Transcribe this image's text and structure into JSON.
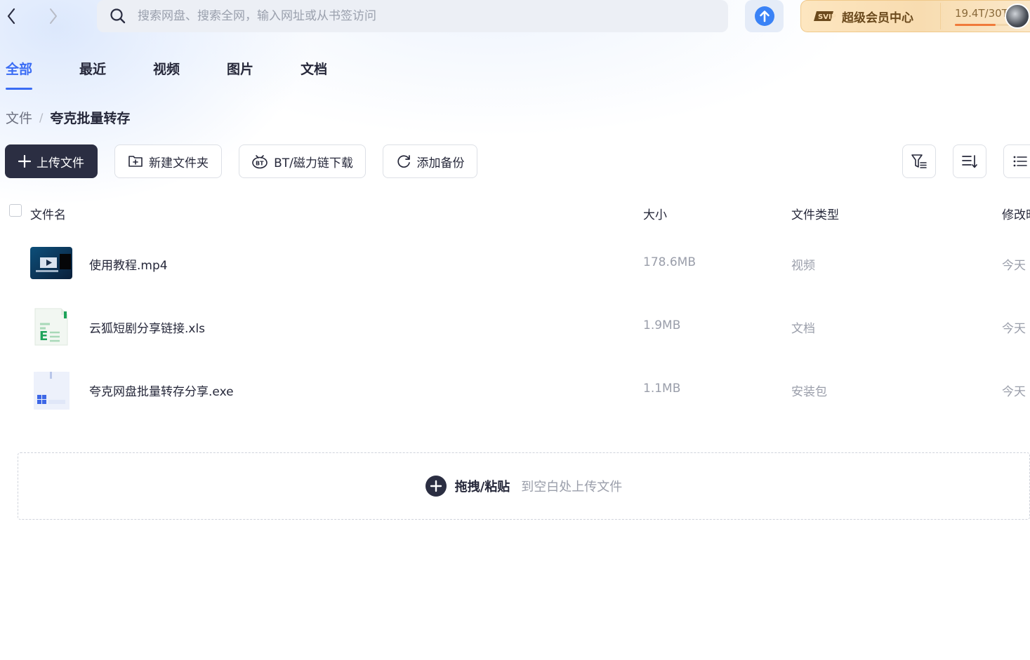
{
  "search": {
    "placeholder": "搜索网盘、搜索全网，输入网址或从书签访问"
  },
  "vip": {
    "label": "超级会员中心",
    "storage": "19.4T/30T",
    "storage_fraction": 0.647
  },
  "tabs": [
    {
      "label": "全部",
      "active": true
    },
    {
      "label": "最近",
      "active": false
    },
    {
      "label": "视频",
      "active": false
    },
    {
      "label": "图片",
      "active": false
    },
    {
      "label": "文档",
      "active": false
    }
  ],
  "breadcrumb": {
    "root": "文件",
    "separator": "/",
    "current": "夸克批量转存"
  },
  "toolbar": {
    "upload_label": "上传文件",
    "new_folder_label": "新建文件夹",
    "bt_label": "BT/磁力链下载",
    "backup_label": "添加备份"
  },
  "columns": {
    "name": "文件名",
    "size": "大小",
    "type": "文件类型",
    "modified": "修改时"
  },
  "files": [
    {
      "name": "使用教程.mp4",
      "size": "178.6MB",
      "type": "视频",
      "modified": "今天",
      "icon": "video-thumbnail-icon"
    },
    {
      "name": "云狐短剧分享链接.xls",
      "size": "1.9MB",
      "type": "文档",
      "modified": "今天",
      "icon": "excel-file-icon"
    },
    {
      "name": "夸克网盘批量转存分享.exe",
      "size": "1.1MB",
      "type": "安装包",
      "modified": "今天",
      "icon": "exe-file-icon"
    }
  ],
  "dropzone": {
    "action": "拖拽/粘贴",
    "hint": "到空白处上传文件"
  },
  "colors": {
    "accent": "#3a6cf4",
    "primary_button": "#2b2e42",
    "vip_text": "#6b4a1d"
  }
}
